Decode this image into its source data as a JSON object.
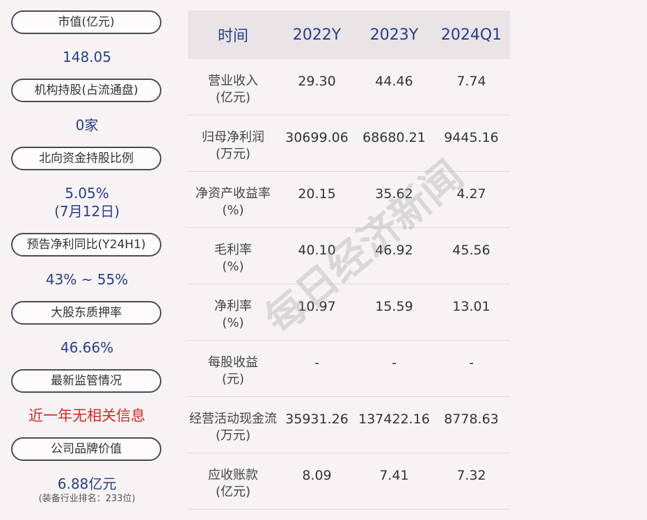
{
  "left": {
    "items": [
      {
        "label": "市值(亿元)",
        "value": "148.05"
      },
      {
        "label": "机构持股(占流通盘)",
        "value": "0家"
      },
      {
        "label": "北向资金持股比例",
        "value": "5.05%",
        "value2": "(7月12日)"
      },
      {
        "label": "预告净利同比(Y24H1)",
        "value": "43% ~ 55%"
      },
      {
        "label": "大股东质押率",
        "value": "46.66%"
      },
      {
        "label": "最新监管情况",
        "value": "近一年无相关信息"
      },
      {
        "label": "公司品牌价值",
        "value": "6.88亿元",
        "note": "(装备行业排名：233位)"
      }
    ]
  },
  "table": {
    "headers": [
      "时间",
      "2022Y",
      "2023Y",
      "2024Q1"
    ],
    "rows": [
      {
        "label": "营业收入",
        "unit": "(亿元)",
        "values": [
          "29.30",
          "44.46",
          "7.74"
        ]
      },
      {
        "label": "归母净利润",
        "unit": "(万元)",
        "values": [
          "30699.06",
          "68680.21",
          "9445.16"
        ]
      },
      {
        "label": "净资产收益率",
        "unit": "(%)",
        "values": [
          "20.15",
          "35.62",
          "4.27"
        ]
      },
      {
        "label": "毛利率",
        "unit": "(%)",
        "values": [
          "40.10",
          "46.92",
          "45.56"
        ]
      },
      {
        "label": "净利率",
        "unit": "(%)",
        "values": [
          "10.97",
          "15.59",
          "13.01"
        ]
      },
      {
        "label": "每股收益",
        "unit": "(元)",
        "values": [
          "-",
          "-",
          "-"
        ]
      },
      {
        "label": "经营活动现金流",
        "unit": "(万元)",
        "values": [
          "35931.26",
          "137422.16",
          "8778.63"
        ]
      },
      {
        "label": "应收账款",
        "unit": "(亿元)",
        "values": [
          "8.09",
          "7.41",
          "7.32"
        ]
      }
    ]
  },
  "watermark": "每日经济新闻",
  "colors": {
    "accent": "#253f8a",
    "alert": "#d42a22",
    "background": "#f7f2f3"
  }
}
